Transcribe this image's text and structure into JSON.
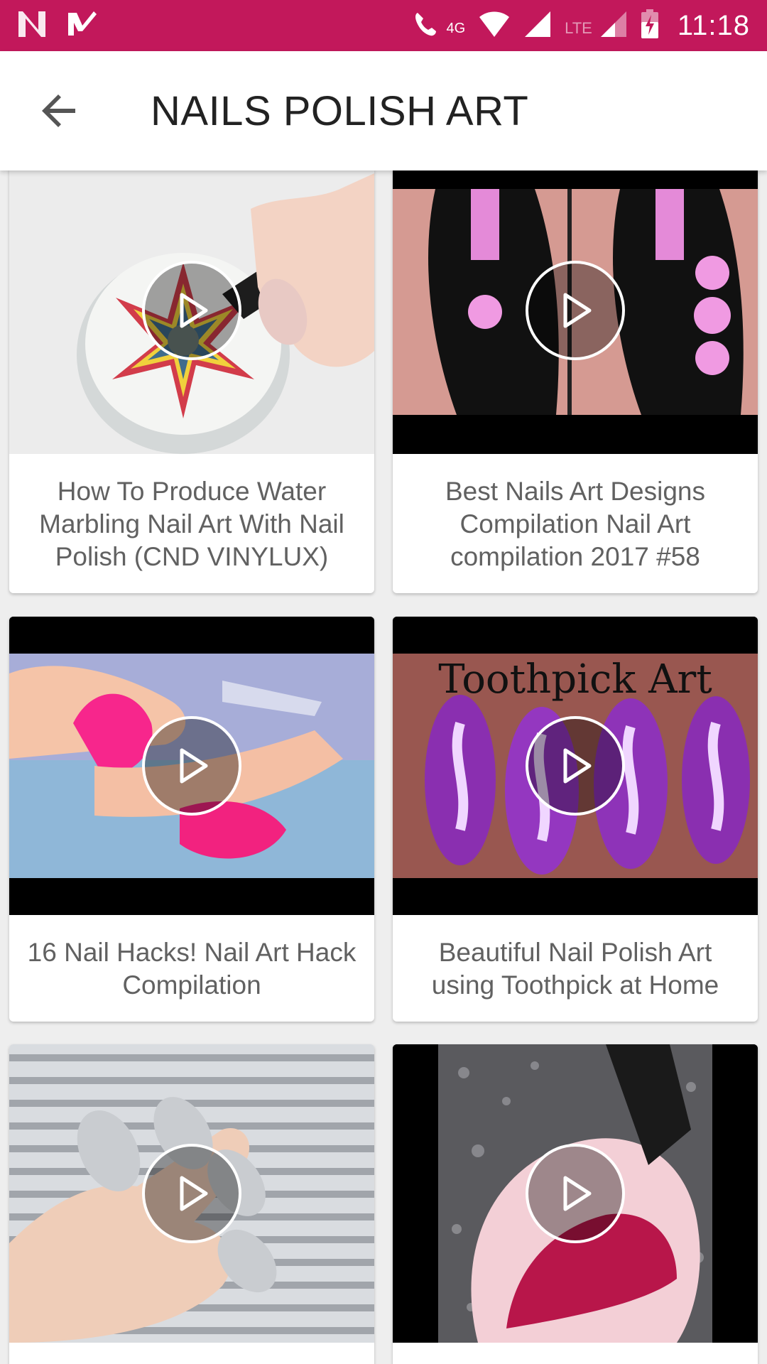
{
  "status_bar": {
    "time": "11:18",
    "network_4g": "4G",
    "network_lte": "LTE",
    "bg_color": "#c2185b"
  },
  "app_bar": {
    "title": "NAILS POLISH ART",
    "back_icon": "arrow-back-icon"
  },
  "videos": [
    {
      "title": "How To Produce Water Marbling Nail Art With Nail Polish (CND VINYLUX)"
    },
    {
      "title": "Best Nails Art Designs Compilation Nail Art compilation 2017 #58"
    },
    {
      "title": "16 Nail Hacks! Nail Art Hack Compilation"
    },
    {
      "title": "Beautiful Nail Polish Art using Toothpick at Home",
      "overlay": "Toothpick Art"
    },
    {
      "title": ""
    },
    {
      "title": ""
    }
  ]
}
